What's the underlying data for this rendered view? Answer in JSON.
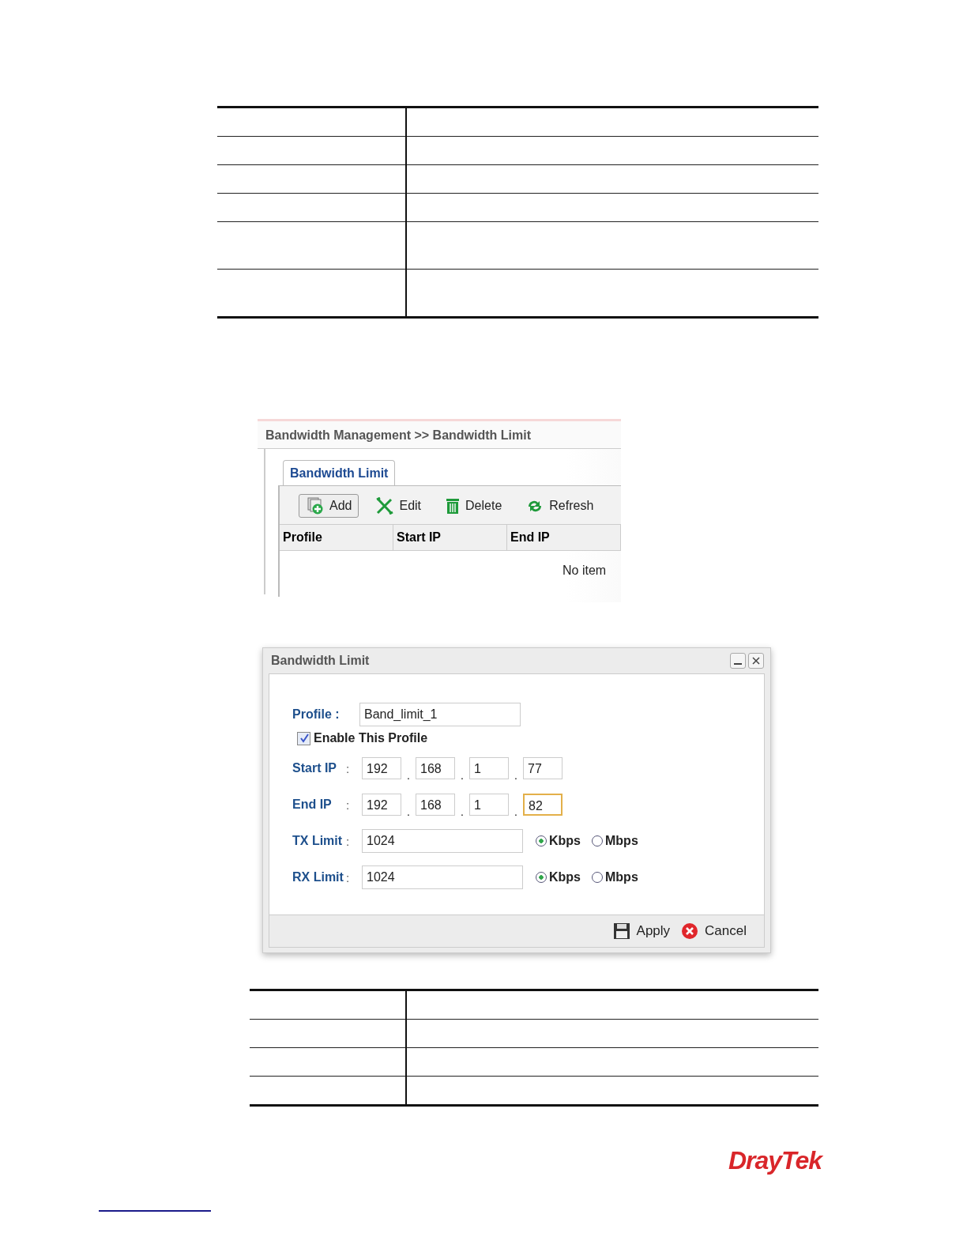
{
  "list_screen": {
    "breadcrumb": "Bandwidth Management >> Bandwidth Limit",
    "tabs": [
      {
        "label": "Bandwidth Limit",
        "selected": true
      }
    ],
    "toolbar": [
      {
        "label": "Add",
        "kind": "add",
        "hovered": true
      },
      {
        "label": "Edit",
        "kind": "edit",
        "hovered": false
      },
      {
        "label": "Delete",
        "kind": "delete",
        "hovered": false
      },
      {
        "label": "Refresh",
        "kind": "refresh",
        "hovered": false
      }
    ],
    "columns": [
      "Profile",
      "Start IP",
      "End IP"
    ],
    "empty_message": "No item"
  },
  "dialog": {
    "title": "Bandwidth Limit",
    "profile": {
      "label": "Profile :",
      "value": "Band_limit_1"
    },
    "enable": {
      "label": "Enable This Profile",
      "checked": true
    },
    "ip_rows": [
      {
        "label": "Start IP",
        "colon": ":",
        "dots": [
          ".",
          ".",
          "."
        ],
        "octets": [
          {
            "value": "192",
            "focused": false
          },
          {
            "value": "168",
            "focused": false
          },
          {
            "value": "1",
            "focused": false
          },
          {
            "value": "77",
            "focused": false
          }
        ]
      },
      {
        "label": "End IP",
        "colon": ":",
        "dots": [
          ".",
          ".",
          "."
        ],
        "octets": [
          {
            "value": "192",
            "focused": false
          },
          {
            "value": "168",
            "focused": false
          },
          {
            "value": "1",
            "focused": false
          },
          {
            "value": "82",
            "focused": true
          }
        ]
      }
    ],
    "limit_rows": [
      {
        "label": "TX Limit",
        "colon": ":",
        "value": "1024",
        "units": [
          {
            "label": "Kbps",
            "selected": true
          },
          {
            "label": "Mbps",
            "selected": false
          }
        ]
      },
      {
        "label": "RX Limit",
        "colon": ":",
        "value": "1024",
        "units": [
          {
            "label": "Kbps",
            "selected": true
          },
          {
            "label": "Mbps",
            "selected": false
          }
        ]
      }
    ],
    "buttons": [
      {
        "label": "Apply",
        "kind": "apply"
      },
      {
        "label": "Cancel",
        "kind": "cancel"
      }
    ]
  },
  "logo": "DrayTek"
}
